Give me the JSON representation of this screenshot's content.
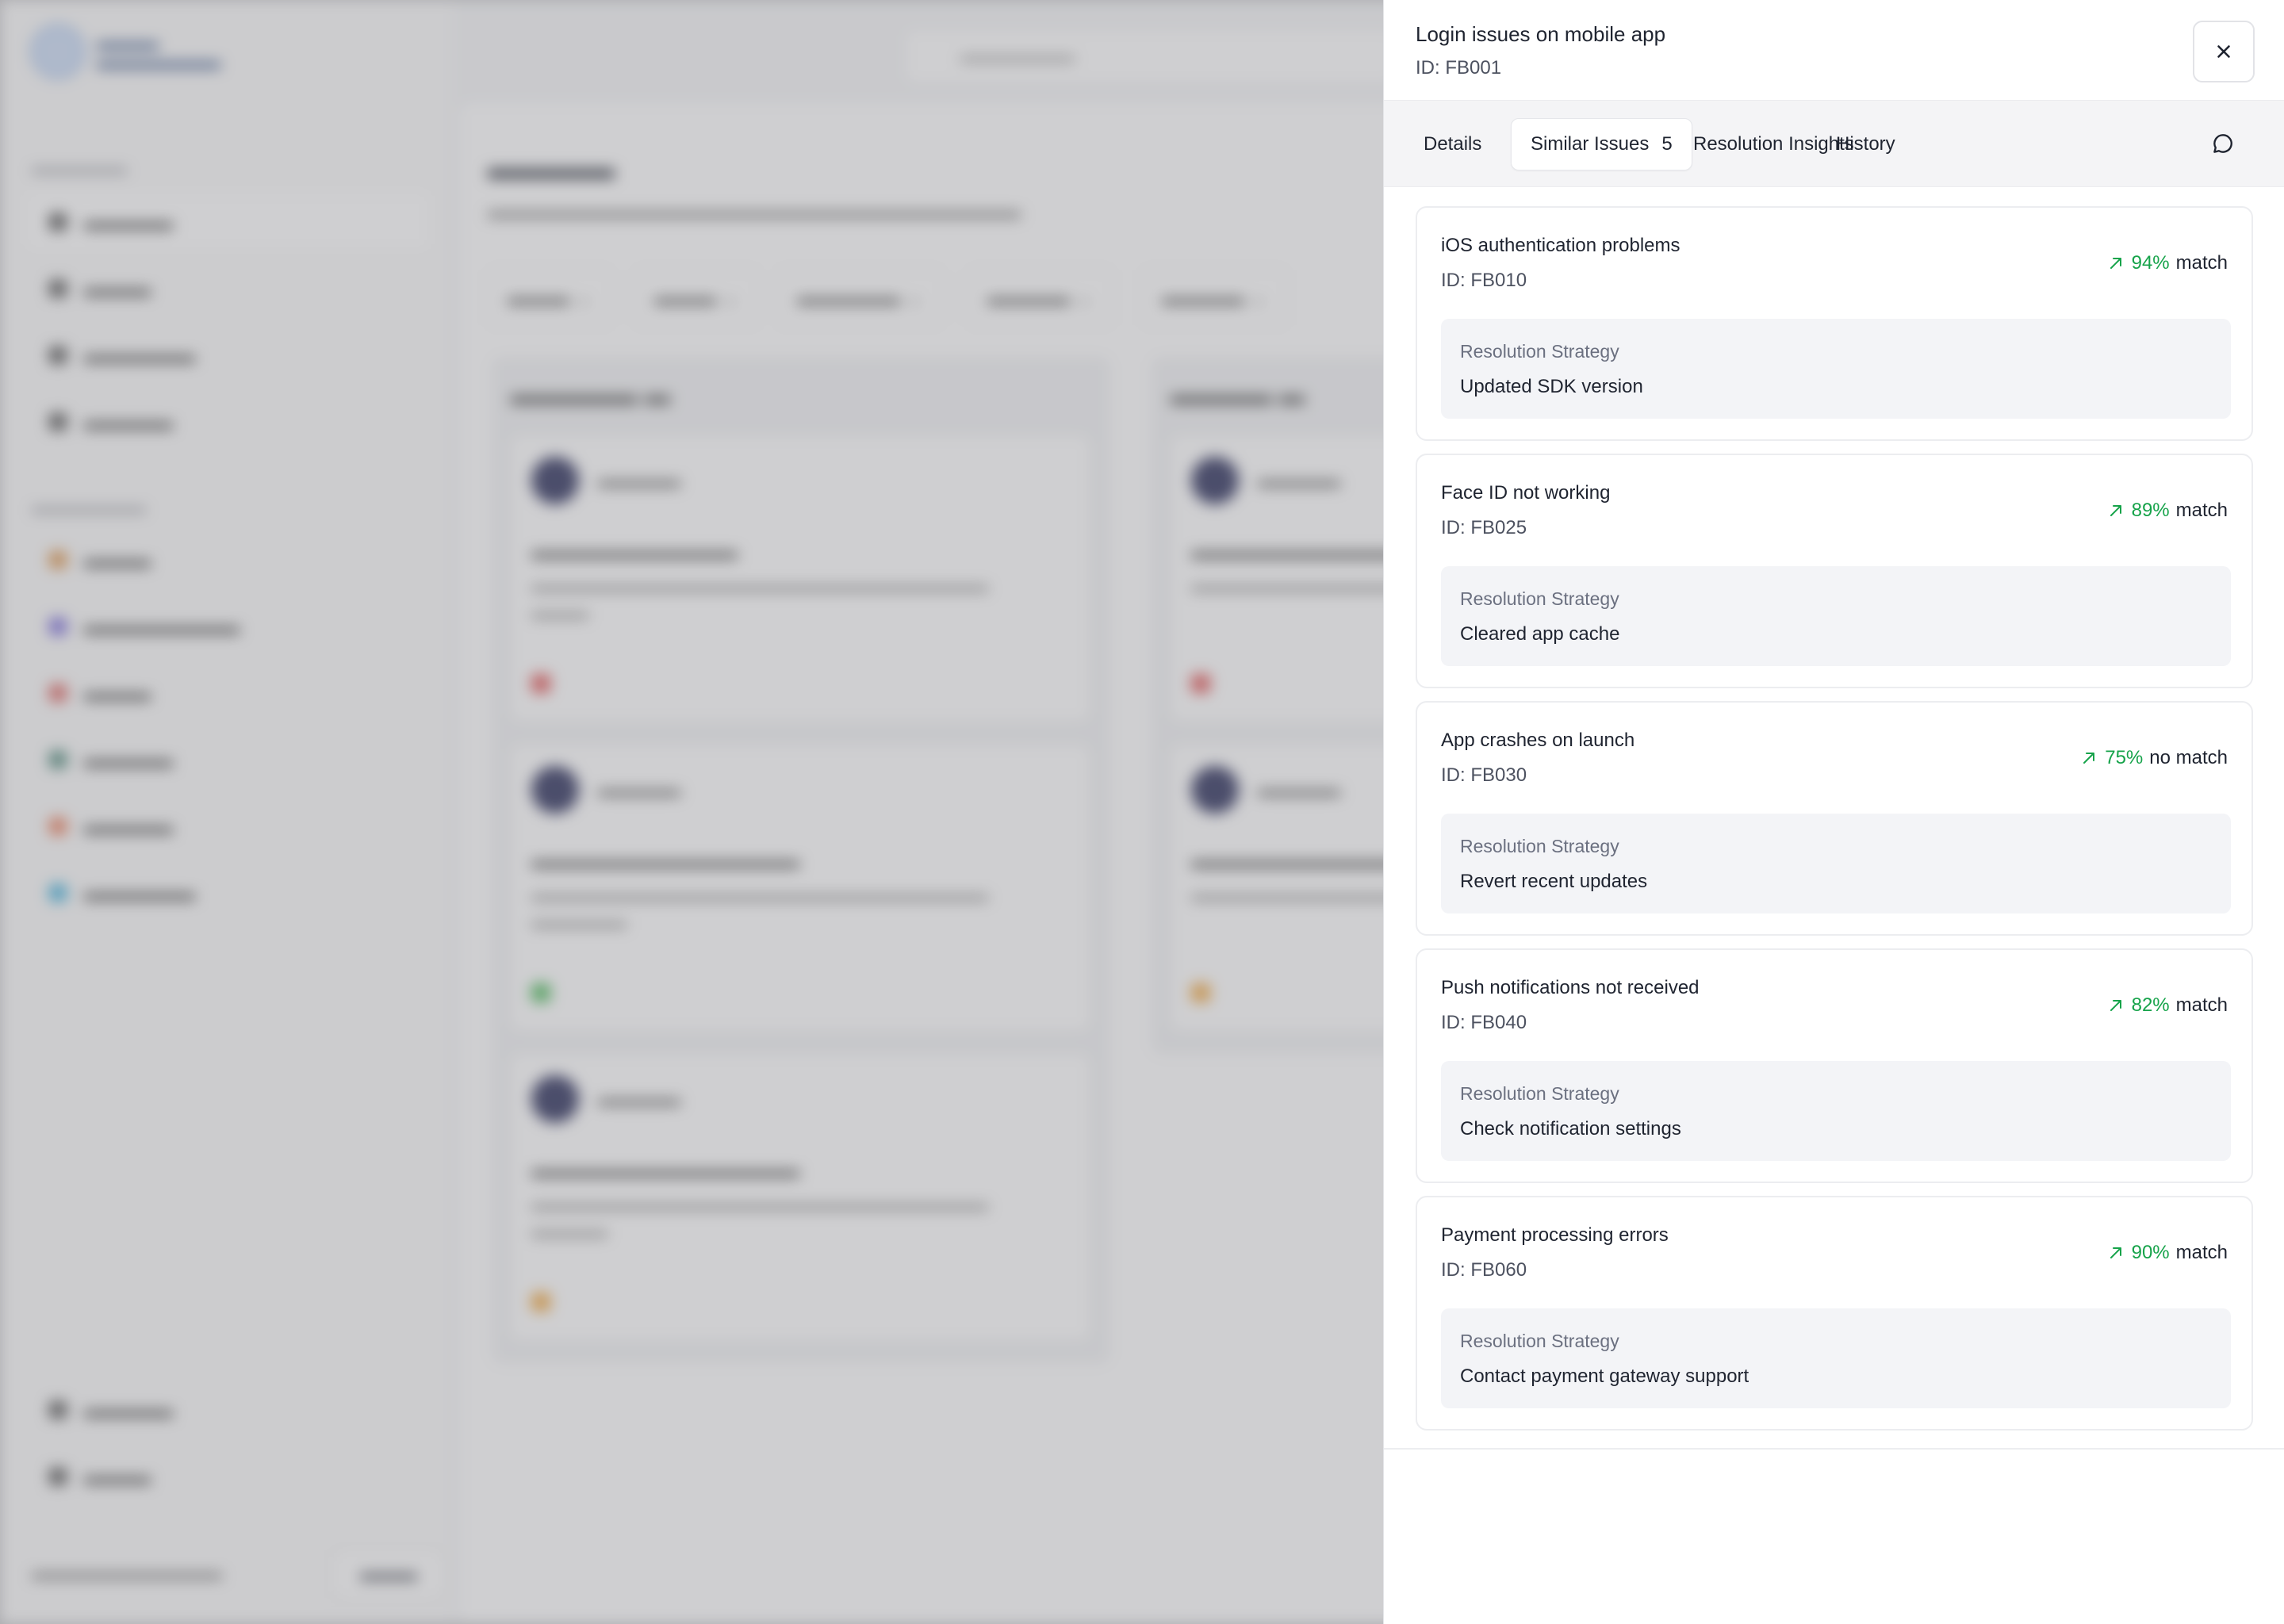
{
  "panel": {
    "title": "Login issues on mobile app",
    "id": "ID: FB001",
    "close_icon": "close-icon",
    "tabs": [
      {
        "label": "Details",
        "active": false
      },
      {
        "label": "Similar Issues",
        "count": "5",
        "active": true
      },
      {
        "label": "Resolution Insights",
        "active": false
      },
      {
        "label": "History",
        "active": false
      }
    ],
    "chat_icon": "chat-bubble-icon",
    "strategy_label": "Resolution Strategy",
    "accent_green": "#16a34a",
    "similar_issues": [
      {
        "title": "iOS authentication problems",
        "id": "ID: FB010",
        "percent": "94%",
        "match_label": "match",
        "strategy": "Updated SDK version"
      },
      {
        "title": "Face ID not working",
        "id": "ID: FB025",
        "percent": "89%",
        "match_label": "match",
        "strategy": "Cleared app cache"
      },
      {
        "title": "App crashes on launch",
        "id": "ID: FB030",
        "percent": "75%",
        "match_label": "no match",
        "strategy": "Revert recent updates"
      },
      {
        "title": "Push notifications not received",
        "id": "ID: FB040",
        "percent": "82%",
        "match_label": "match",
        "strategy": "Check notification settings"
      },
      {
        "title": "Payment processing errors",
        "id": "ID: FB060",
        "percent": "90%",
        "match_label": "match",
        "strategy": "Contact payment gateway support"
      }
    ]
  }
}
